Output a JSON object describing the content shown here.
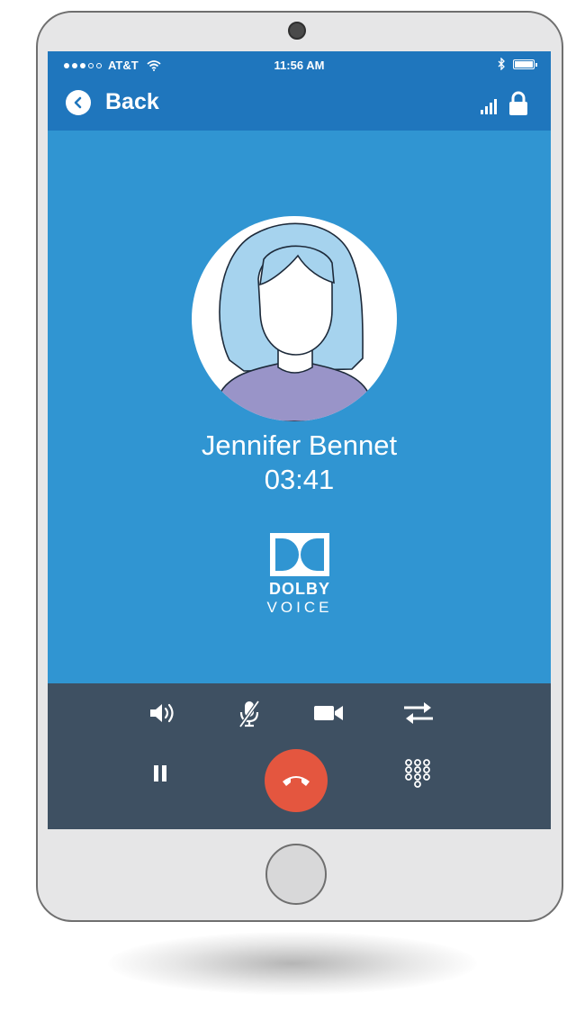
{
  "status_bar": {
    "signal_dots_filled": 3,
    "signal_dots_total": 5,
    "carrier": "AT&T",
    "time": "11:56 AM"
  },
  "nav": {
    "back_label": "Back"
  },
  "call": {
    "caller_name": "Jennifer Bennet",
    "duration": "03:41"
  },
  "branding": {
    "line1": "DOLBY",
    "line2": "VOICE"
  },
  "icons": {
    "back": "chevron-left-icon",
    "wifi": "wifi-icon",
    "bluetooth": "bluetooth-icon",
    "battery": "battery-icon",
    "signal": "signal-bars-icon",
    "lock": "lock-icon",
    "speaker": "speaker-icon",
    "mute": "mute-mic-icon",
    "video": "video-camera-icon",
    "transfer": "transfer-arrows-icon",
    "hold": "pause-icon",
    "end_call": "end-call-icon",
    "keypad": "keypad-icon"
  },
  "colors": {
    "screen_bg": "#3095d2",
    "header_bg": "#1f76bd",
    "controls_bg": "#3e5062",
    "end_call": "#e4563f",
    "avatar_hair": "#a6d3ee",
    "avatar_shirt": "#9994c8"
  }
}
